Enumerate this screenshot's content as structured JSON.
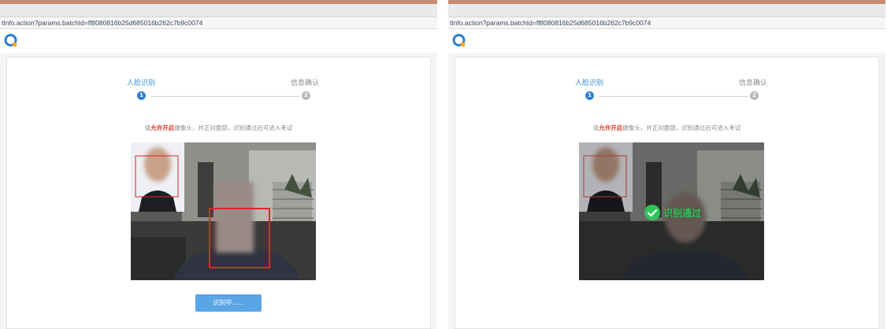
{
  "browser": {
    "url_left": "tInfo.action?params.batchId=ff8080816b25d685016b262c7b9c0074",
    "url_right": "tInfo.action?params.batchId=ff8080816b25d685016b262c7b9c0074"
  },
  "logo": {
    "icon": "app-logo-icon",
    "colors": [
      "#2c7fd1",
      "#f5a623"
    ]
  },
  "steps": [
    {
      "label": "人脸识别",
      "number": "1",
      "state": "active"
    },
    {
      "label": "信息确认",
      "number": "2",
      "state": "inactive"
    }
  ],
  "instruction": {
    "prefix": "请",
    "highlight": "允许开启",
    "suffix": "摄像头，并正对面部，识别通过后可进入考试"
  },
  "left_panel": {
    "button_label": "识别中......"
  },
  "right_panel": {
    "status_icon": "check-circle-icon",
    "status_text": "识别通过"
  },
  "colors": {
    "accent": "#3f8ed8",
    "highlight": "#e03a2f",
    "success": "#2fc45a",
    "face_box": "#e0262a"
  }
}
